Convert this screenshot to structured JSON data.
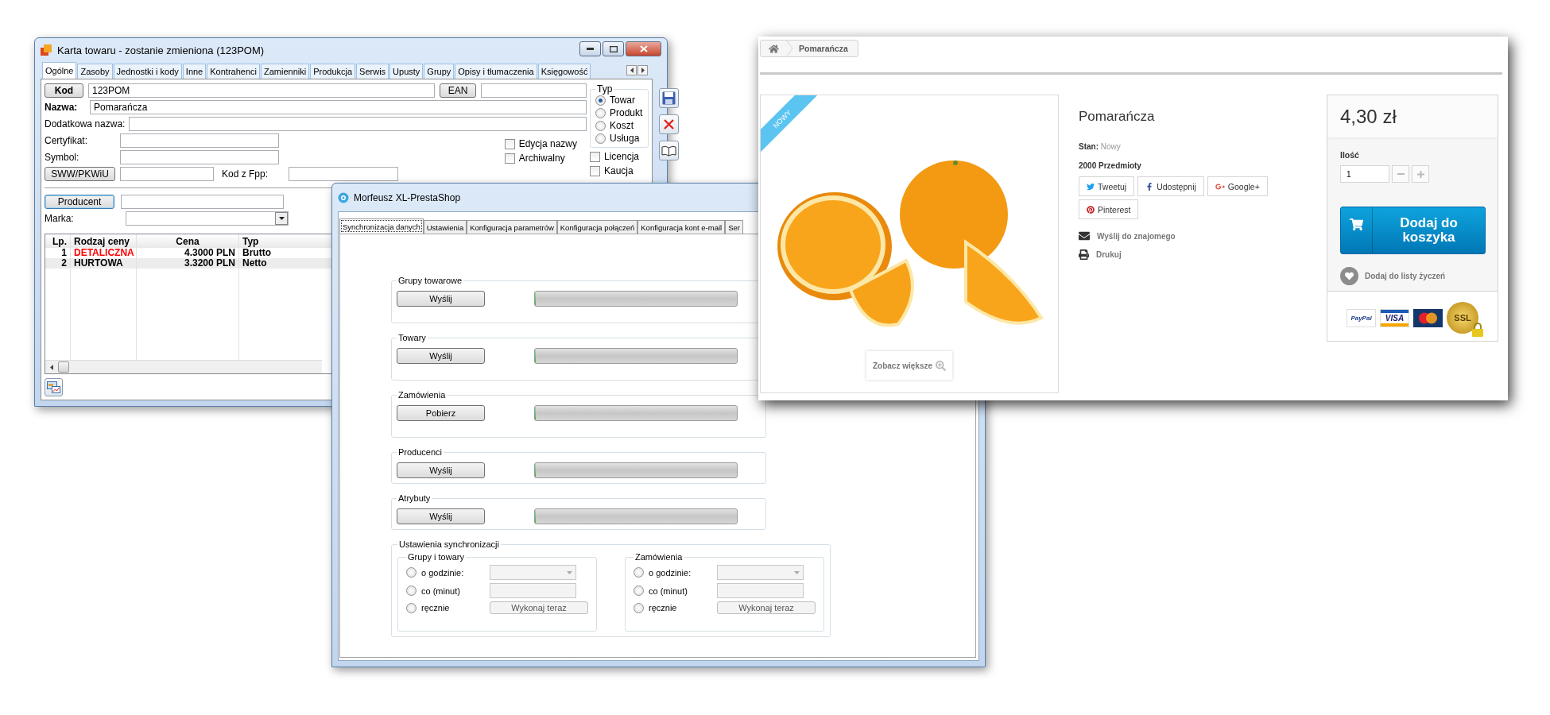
{
  "item_card": {
    "title": "Karta towaru - zostanie zmieniona (123POM)",
    "tabs": [
      {
        "label": "Ogólne",
        "selected": true
      },
      {
        "label": "Zasoby",
        "selected": false
      },
      {
        "label": "Jednostki i kody",
        "selected": false
      },
      {
        "label": "Inne",
        "selected": false
      },
      {
        "label": "Kontrahenci",
        "selected": false
      },
      {
        "label": "Zamienniki",
        "selected": false
      },
      {
        "label": "Produkcja",
        "selected": false
      },
      {
        "label": "Serwis",
        "selected": false
      },
      {
        "label": "Upusty",
        "selected": false
      },
      {
        "label": "Grupy",
        "selected": false
      },
      {
        "label": "Opisy i tłumaczenia",
        "selected": false
      },
      {
        "label": "Księgowość",
        "selected": false
      }
    ],
    "code_button": "Kod",
    "code_value": "123POM",
    "ean_button": "EAN",
    "name_label": "Nazwa:",
    "name_value": "Pomarańcza",
    "extra_name_label": "Dodatkowa nazwa:",
    "certificate_label": "Certyfikat:",
    "symbol_label": "Symbol:",
    "sww_button": "SWW/PKWiU",
    "fpp_label": "Kod z Fpp:",
    "flags": [
      {
        "label": "Edycja nazwy",
        "checked": false
      },
      {
        "label": "Archiwalny",
        "checked": false
      }
    ],
    "type_group": {
      "title": "Typ",
      "options": [
        {
          "label": "Towar",
          "selected": true
        },
        {
          "label": "Produkt",
          "selected": false
        },
        {
          "label": "Koszt",
          "selected": false
        },
        {
          "label": "Usługa",
          "selected": false
        }
      ]
    },
    "extra_flags": [
      {
        "label": "Licencja",
        "checked": false
      },
      {
        "label": "Kaucja",
        "checked": false
      }
    ],
    "producer_button": "Producent",
    "brand_label": "Marka:",
    "price_table": {
      "columns": [
        "Lp.",
        "Rodzaj ceny",
        "Cena",
        "Typ"
      ],
      "rows": [
        {
          "cells": [
            "1",
            "DETALICZNA",
            "4.3000 PLN",
            "Brutto"
          ],
          "color": "#ff0000"
        },
        {
          "cells": [
            "2",
            "HURTOWA",
            "3.3200 PLN",
            "Netto"
          ],
          "color": "#000000"
        }
      ]
    }
  },
  "sync_window": {
    "title": "Morfeusz XL-PrestaShop",
    "tabs": [
      {
        "label": "Synchronizacja danych",
        "selected": true
      },
      {
        "label": "Ustawienia",
        "selected": false
      },
      {
        "label": "Konfiguracja parametrów",
        "selected": false
      },
      {
        "label": "Konfiguracja połączeń",
        "selected": false
      },
      {
        "label": "Konfiguracja kont e-mail",
        "selected": false
      },
      {
        "label": "Ser",
        "selected": false
      }
    ],
    "sections": [
      {
        "title": "Grupy towarowe",
        "button": "Wyślij",
        "level": 0
      },
      {
        "title": "Towary",
        "button": "Wyślij",
        "level": 0
      },
      {
        "title": "Zamówienia",
        "button": "Pobierz",
        "level": 0
      },
      {
        "title": "Producenci",
        "button": "Wyślij",
        "level": 0
      },
      {
        "title": "Atrybuty",
        "button": "Wyślij",
        "level": 0
      }
    ],
    "schedule": {
      "title": "Ustawienia synchronizacji",
      "groups": [
        {
          "title": "Grupy i towary",
          "options": [
            {
              "kind": "time",
              "label": "o godzinie:",
              "selected": false
            },
            {
              "kind": "interval",
              "label": "co (minut)",
              "selected": false
            },
            {
              "kind": "manual",
              "label": "ręcznie",
              "selected": false,
              "button": "Wykonaj teraz"
            }
          ]
        },
        {
          "title": "Zamówienia",
          "options": [
            {
              "kind": "time",
              "label": "o godzinie:",
              "selected": false
            },
            {
              "kind": "interval",
              "label": "co (minut)",
              "selected": false
            },
            {
              "kind": "manual",
              "label": "ręcznie",
              "selected": false,
              "button": "Wykonaj teraz"
            }
          ]
        }
      ]
    }
  },
  "shop_page": {
    "breadcrumb": [
      "Pomarańcza"
    ],
    "badge": "NOWY",
    "zoom_button": "Zobacz większe",
    "product": {
      "title": "Pomarańcza",
      "condition": "**Stan:** Nowy",
      "stock": "2000 Przedmioty",
      "share_buttons": [
        {
          "kind": "twitter",
          "label": "Tweetuj"
        },
        {
          "kind": "facebook",
          "label": "Udostępnij"
        },
        {
          "kind": "google",
          "label": "Google+"
        },
        {
          "kind": "pinterest",
          "label": "Pinterest"
        }
      ],
      "links": [
        {
          "kind": "email",
          "label": "Wyślij do znajomego"
        },
        {
          "kind": "print",
          "label": "Drukuj"
        }
      ]
    },
    "buy_box": {
      "price": "4,30 zł",
      "quantity_label": "Ilość",
      "quantity": "1",
      "add_to_cart": "Dodaj do koszyka",
      "wishlist": "Dodaj do listy życzeń",
      "payment_logos": [
        {
          "kind": "paypal",
          "label": "PayPal"
        },
        {
          "kind": "visa",
          "label": "VISA"
        },
        {
          "kind": "mastercard"
        },
        {
          "kind": "ssl",
          "label": "SSL"
        }
      ]
    }
  }
}
